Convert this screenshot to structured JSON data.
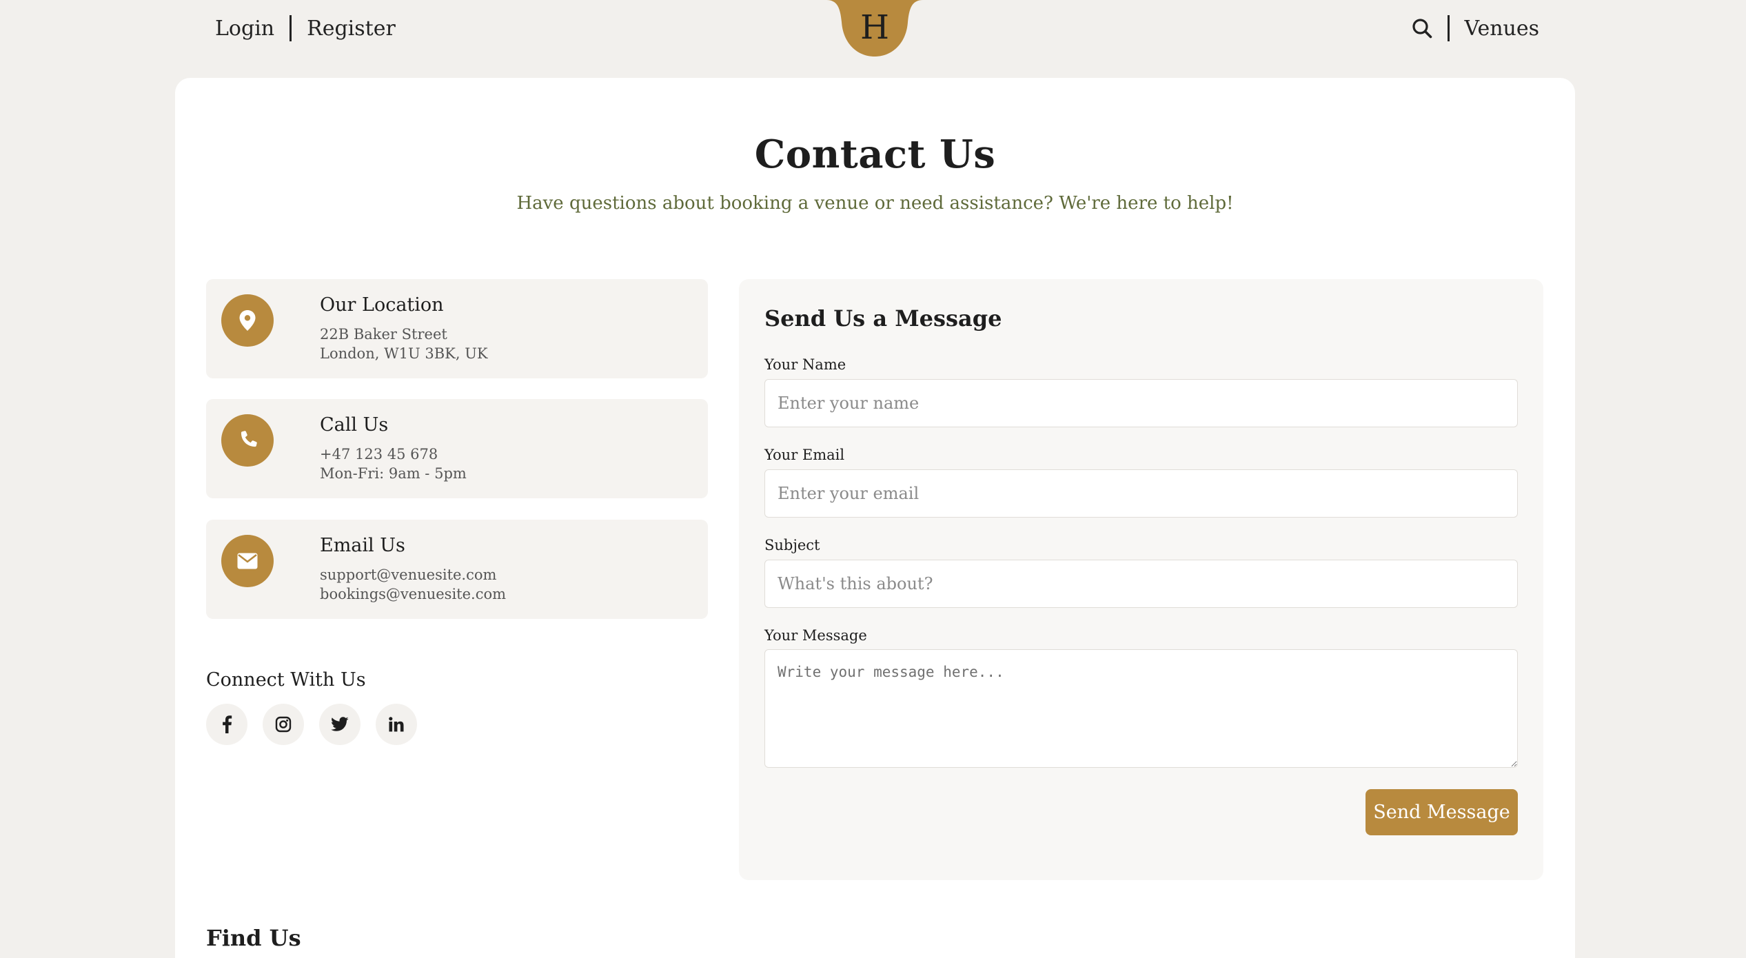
{
  "header": {
    "login_label": "Login",
    "register_label": "Register",
    "logo_letter": "H",
    "search_icon": "search-icon",
    "venues_label": "Venues"
  },
  "main": {
    "title": "Contact Us",
    "subtitle": "Have questions about booking a venue or need assistance? We're here to help!"
  },
  "info": [
    {
      "icon": "location-pin-icon",
      "title": "Our Location",
      "line1": "22B Baker Street",
      "line2": "London, W1U 3BK, UK"
    },
    {
      "icon": "phone-icon",
      "title": "Call Us",
      "line1": "+47 123 45 678",
      "line2": "Mon-Fri: 9am - 5pm"
    },
    {
      "icon": "envelope-icon",
      "title": "Email Us",
      "line1": "support@venuesite.com",
      "line2": "bookings@venuesite.com"
    }
  ],
  "connect": {
    "title": "Connect With Us",
    "icons": [
      "facebook-icon",
      "instagram-icon",
      "twitter-icon",
      "linkedin-icon"
    ]
  },
  "form": {
    "title": "Send Us a Message",
    "name_label": "Your Name",
    "name_placeholder": "Enter your name",
    "email_label": "Your Email",
    "email_placeholder": "Enter your email",
    "subject_label": "Subject",
    "subject_placeholder": "What's this about?",
    "message_label": "Your Message",
    "message_placeholder": "Write your message here...",
    "send_label": "Send Message"
  },
  "find_us": {
    "title": "Find Us"
  },
  "colors": {
    "accent": "#b88a3e",
    "background": "#f2f0ed",
    "card": "#ffffff",
    "subtitle": "#5f6a3a"
  }
}
